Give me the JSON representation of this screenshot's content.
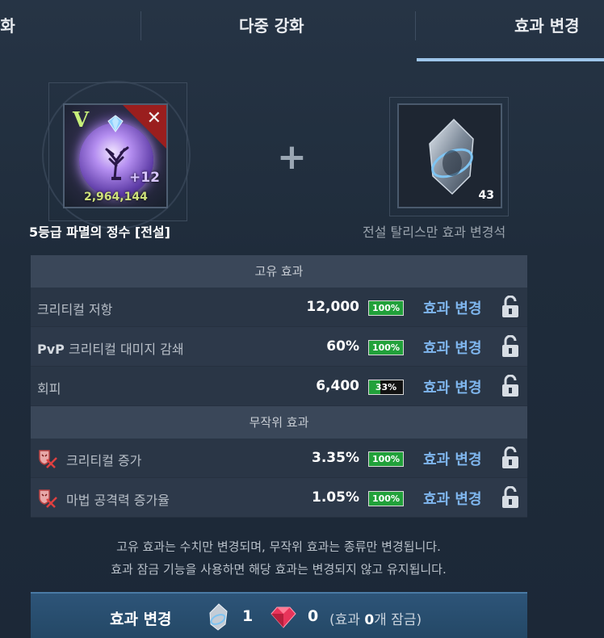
{
  "tabs": [
    {
      "label": "강화"
    },
    {
      "label": "다중 강화"
    },
    {
      "label": "효과 변경"
    }
  ],
  "item": {
    "grade_mark": "V",
    "level": "+12",
    "power": "2,964,144",
    "name": "5등급 파멸의 정수 [전설]"
  },
  "material": {
    "count": "43",
    "name": "전설 탈리스만 효과 변경석"
  },
  "plus_symbol": "+",
  "unique_section": {
    "title": "고유 효과",
    "rows": [
      {
        "name": "크리티컬 저항",
        "value": "12,000",
        "pct_label": "100%",
        "pct": 1.0,
        "action": "효과 변경"
      },
      {
        "name_prefix": "PvP",
        "name": " 크리티컬 대미지 감쇄",
        "value": "60%",
        "pct_label": "100%",
        "pct": 1.0,
        "action": "효과 변경"
      },
      {
        "name": "회피",
        "value": "6,400",
        "pct_label": "33%",
        "pct": 0.33,
        "action": "효과 변경"
      }
    ]
  },
  "random_section": {
    "title": "무작위 효과",
    "rows": [
      {
        "name": "크리티컬 증가",
        "value": "3.35%",
        "pct_label": "100%",
        "pct": 1.0,
        "action": "효과 변경"
      },
      {
        "name": "마법 공격력 증가율",
        "value": "1.05%",
        "pct_label": "100%",
        "pct": 1.0,
        "action": "효과 변경"
      }
    ]
  },
  "notice": {
    "line1": "고유 효과는 수치만 변경되며, 무작위 효과는 종류만 변경됩니다.",
    "line2": "효과 잠금 기능을 사용하면 해당 효과는 변경되지 않고 유지됩니다."
  },
  "bottom_button": {
    "label": "효과 변경",
    "stone_cost": "1",
    "gem_cost": "0",
    "lock_prefix": "(효과 ",
    "lock_count": "0",
    "lock_suffix": "개 잠금)"
  },
  "colors": {
    "accent": "#7fb6ee",
    "tab_underline": "#9ec5ea",
    "percent_fill": "#21a13a",
    "corner_badge": "#9a1e1e"
  }
}
